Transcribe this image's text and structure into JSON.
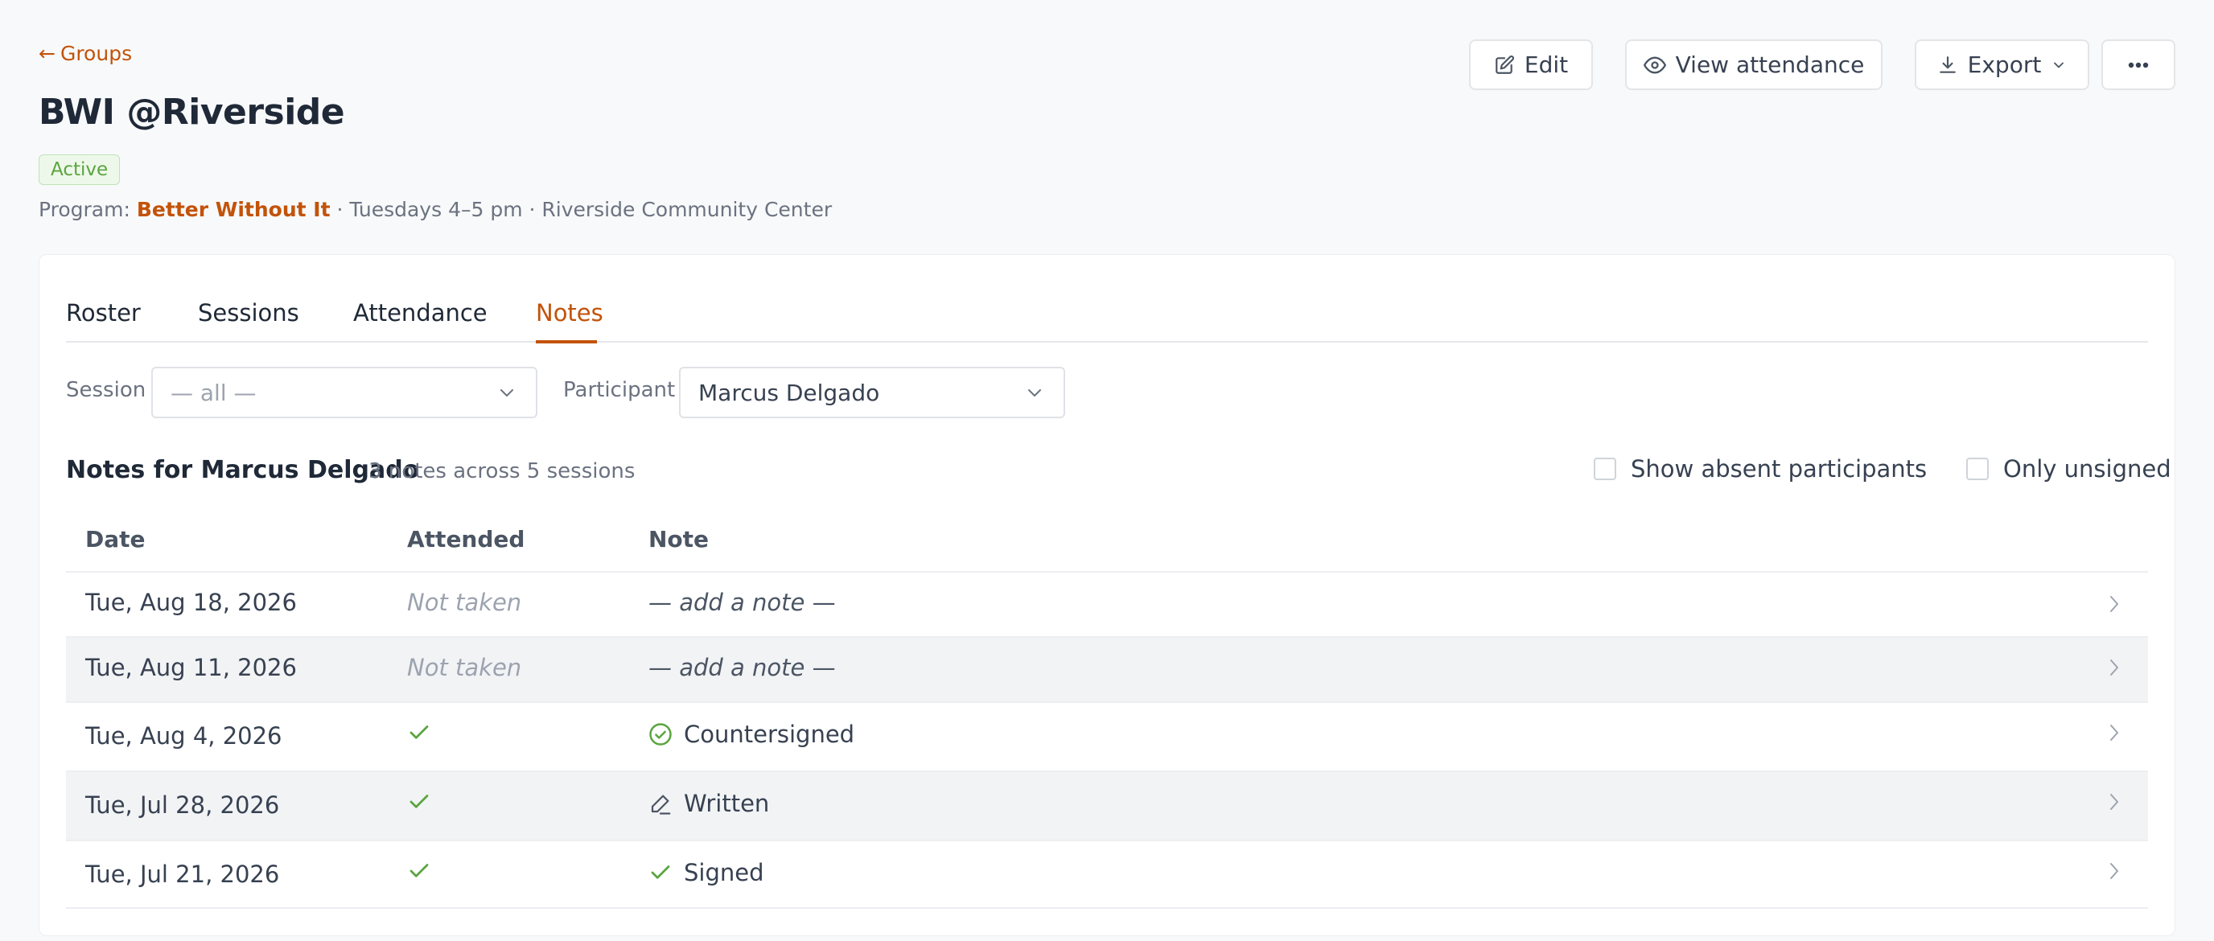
{
  "header": {
    "back_label": "Groups",
    "title": "BWI @Riverside",
    "status": "Active",
    "program_prefix": "Program:",
    "program_name": "Better Without It",
    "schedule": " · Tuesdays 4–5 pm · Riverside Community Center"
  },
  "actions": {
    "edit": "Edit",
    "view_attendance": "View attendance",
    "export": "Export"
  },
  "tabs": [
    {
      "label": "Roster"
    },
    {
      "label": "Sessions"
    },
    {
      "label": "Attendance"
    },
    {
      "label": "Notes",
      "active": true
    }
  ],
  "filters": {
    "session_label": "Session",
    "session_value": "— all —",
    "participant_label": "Participant",
    "participant_value": "Marcus Delgado"
  },
  "notes": {
    "title": "Notes for Marcus Delgado",
    "subtitle": "3 notes across 5 sessions",
    "show_absent_label": "Show absent participants",
    "only_unsigned_label": "Only unsigned"
  },
  "table": {
    "columns": [
      "Date",
      "Attended",
      "Note"
    ],
    "rows": [
      {
        "date": "Tue, Aug 18, 2026",
        "attended": "Not taken",
        "note": "— add a note —",
        "note_icon": "none"
      },
      {
        "date": "Tue, Aug 11, 2026",
        "attended": "Not taken",
        "note": "— add a note —",
        "note_icon": "none"
      },
      {
        "date": "Tue, Aug 4, 2026",
        "attended": "check-icon",
        "note": "Countersigned",
        "note_icon": "check-circle-icon"
      },
      {
        "date": "Tue, Jul 28, 2026",
        "attended": "check-icon",
        "note": "Written",
        "note_icon": "pencil-icon"
      },
      {
        "date": "Tue, Jul 21, 2026",
        "attended": "check-icon",
        "note": "Signed",
        "note_icon": "check-icon"
      }
    ]
  },
  "colors": {
    "accent": "#c2530a",
    "success": "#5aa540",
    "text": "#1f2937",
    "muted": "#6b7280"
  }
}
